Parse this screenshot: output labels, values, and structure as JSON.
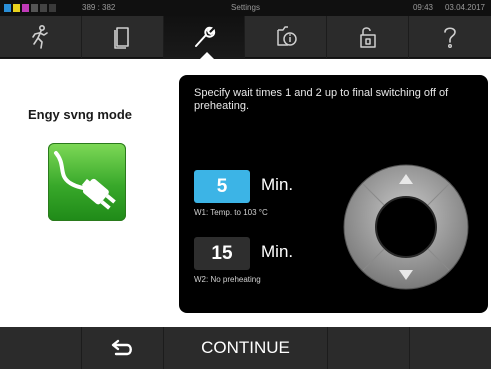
{
  "statusbar": {
    "counter": "389 : 382",
    "title": "Settings",
    "time": "09:43",
    "date": "03.04.2017"
  },
  "tabs": [
    {
      "icon": "running-person-icon"
    },
    {
      "icon": "document-icon"
    },
    {
      "icon": "wrench-icon"
    },
    {
      "icon": "info-document-icon"
    },
    {
      "icon": "lock-icon"
    },
    {
      "icon": "question-mark-icon"
    }
  ],
  "main": {
    "mode_title": "Engy svng mode",
    "description": "Specify wait times 1 and 2 up to final switching off of preheating.",
    "w1": {
      "value": "5",
      "unit": "Min.",
      "label": "W1: Temp. to 103 °C"
    },
    "w2": {
      "value": "15",
      "unit": "Min.",
      "label": "W2: No preheating"
    }
  },
  "bottombar": {
    "continue_label": "CONTINUE"
  },
  "colors": {
    "selected_value": "#3cb4e6",
    "tile_green": "#38a82a"
  }
}
